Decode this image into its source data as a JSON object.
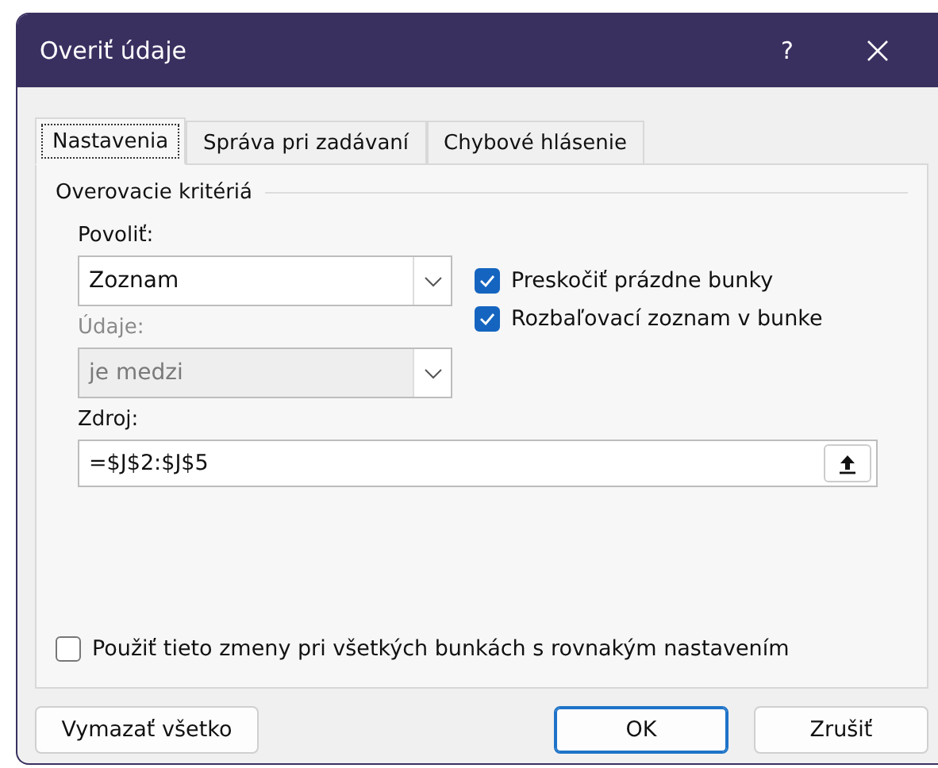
{
  "window": {
    "title": "Overiť údaje",
    "help": "?"
  },
  "tabs": [
    {
      "label": "Nastavenia",
      "selected": true
    },
    {
      "label": "Správa pri zadávaní",
      "selected": false
    },
    {
      "label": "Chybové hlásenie",
      "selected": false
    }
  ],
  "group": {
    "title": "Overovacie kritériá"
  },
  "allow": {
    "label": "Povoliť:",
    "value": "Zoznam",
    "disabled": false
  },
  "data": {
    "label": "Údaje:",
    "value": "je medzi",
    "disabled": true
  },
  "options": [
    {
      "label": "Preskočiť prázdne bunky",
      "checked": true
    },
    {
      "label": "Rozbaľovací zoznam v bunke",
      "checked": true
    }
  ],
  "source": {
    "label": "Zdroj:",
    "value": "=$J$2:$J$5"
  },
  "apply_all": {
    "label": "Použiť tieto zmeny pri všetkých bunkách s rovnakým nastavením",
    "checked": false
  },
  "buttons": [
    {
      "label": "Vymazať všetko",
      "kind": "clear"
    },
    {
      "label": "OK",
      "kind": "default"
    },
    {
      "label": "Zrušiť",
      "kind": "cancel"
    }
  ]
}
